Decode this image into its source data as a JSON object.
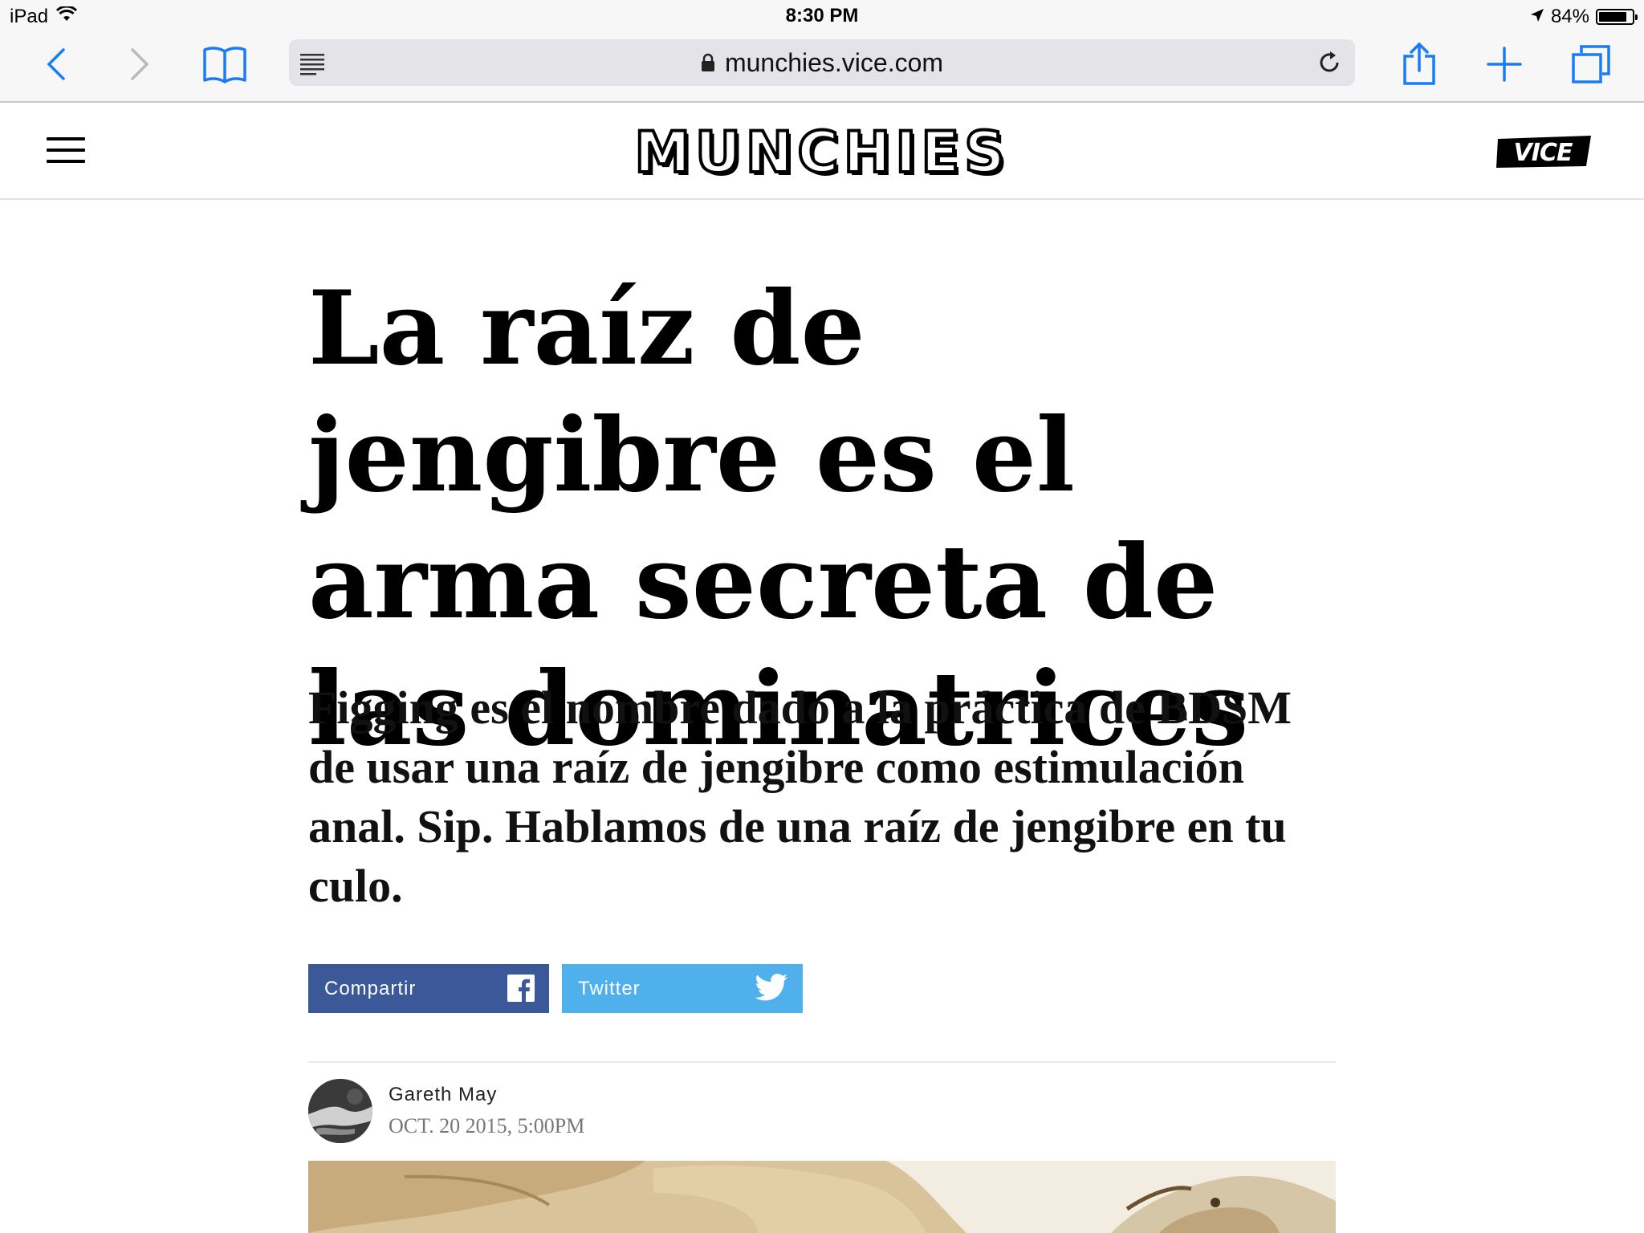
{
  "status_bar": {
    "device": "iPad",
    "time": "8:30 PM",
    "battery_percent": "84%",
    "battery_level": 0.84
  },
  "browser": {
    "url": "munchies.vice.com",
    "accent_color": "#1a7cf5"
  },
  "site": {
    "logo": "MUNCHIES",
    "partner_logo": "VICE"
  },
  "article": {
    "headline": "La raíz de jengibre es el arma secreta de las dominatrices",
    "dek": "Figging es el nombre dado a la práctica de BDSM de usar una raíz de jengibre como estimulación anal. Sip. Hablamos de una raíz de jengibre en tu culo.",
    "share": {
      "facebook_label": "Compartir",
      "twitter_label": "Twitter",
      "facebook_color": "#3b5998",
      "twitter_color": "#4fb0ec"
    },
    "author": "Gareth May",
    "date": "OCT. 20 2015, 5:00PM"
  }
}
